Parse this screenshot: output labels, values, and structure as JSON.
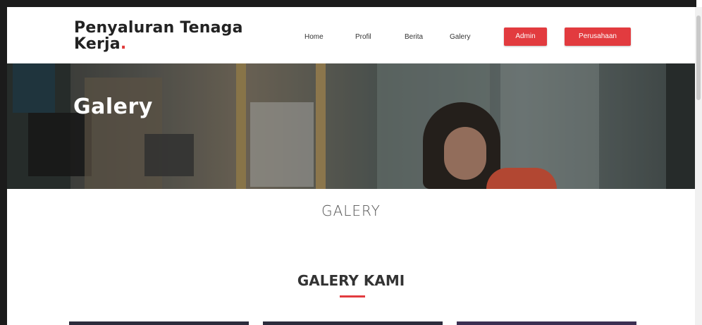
{
  "header": {
    "logo_line1": "Penyaluran Tenaga",
    "logo_line2": "Kerja",
    "logo_dot": ".",
    "nav": {
      "home": "Home",
      "profil": "Profil",
      "berita": "Berita",
      "galery": "Galery",
      "admin": "Admin",
      "perusahaan": "Perusahaan"
    }
  },
  "hero": {
    "title": "Galery"
  },
  "content": {
    "section_label": "GALERY",
    "section_heading": "GALERY KAMI"
  },
  "colors": {
    "accent": "#e23b3f",
    "text_dark": "#222222"
  }
}
